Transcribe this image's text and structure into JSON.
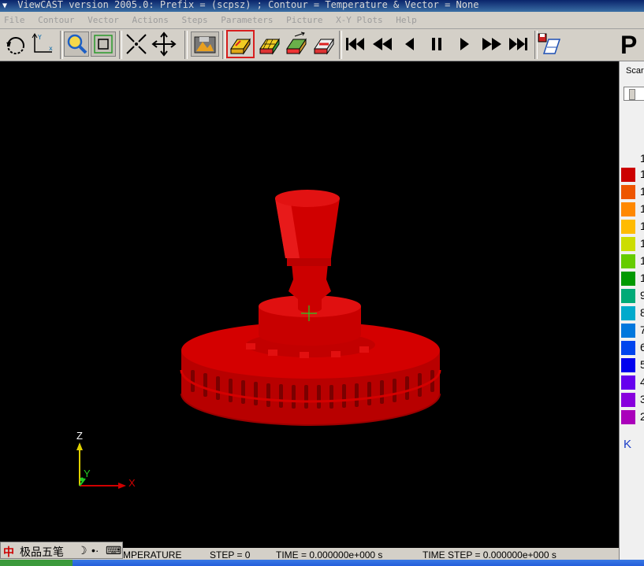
{
  "window": {
    "title": "ViewCAST version 2005.0:  Prefix = (scpsz) ; Contour = Temperature  &  Vector = None"
  },
  "menu": [
    "File",
    "Contour",
    "Vector",
    "Actions",
    "Steps",
    "Parameters",
    "Picture",
    "X-Y Plots",
    "Help"
  ],
  "toolbar": {
    "icons": [
      "rotate-icon",
      "axes-icon",
      "zoom-icon",
      "fit-window-icon",
      "shrink-icon",
      "pan-icon",
      "save-picture-icon",
      "contour-mode-icon",
      "contour-mesh-icon",
      "vector-mode-icon",
      "section-mode-icon",
      "first-step-icon",
      "fast-rewind-icon",
      "step-back-icon",
      "pause-icon",
      "step-forward-icon",
      "fast-forward-icon",
      "last-step-icon",
      "record-icon"
    ]
  },
  "right_panel": {
    "partial_title": "P",
    "scan_label": "Scar",
    "legend_top_label": "1",
    "legend": [
      {
        "label": "1",
        "color": "#cc0000"
      },
      {
        "label": "1",
        "color": "#ee5500"
      },
      {
        "label": "1",
        "color": "#ff8800"
      },
      {
        "label": "1",
        "color": "#ffbb00"
      },
      {
        "label": "1",
        "color": "#ccdd00"
      },
      {
        "label": "1",
        "color": "#66cc00"
      },
      {
        "label": "1",
        "color": "#009900"
      },
      {
        "label": "9",
        "color": "#00aa77"
      },
      {
        "label": "8",
        "color": "#00aacc"
      },
      {
        "label": "7",
        "color": "#0077dd"
      },
      {
        "label": "6",
        "color": "#0044ee"
      },
      {
        "label": "5",
        "color": "#0000ee"
      },
      {
        "label": "4",
        "color": "#6600ee"
      },
      {
        "label": "3",
        "color": "#8800dd"
      },
      {
        "label": "2",
        "color": "#aa00bb"
      }
    ],
    "unit": "K"
  },
  "axes": {
    "z": "Z",
    "y": "Y",
    "x": "X"
  },
  "status": {
    "field": "MPERATURE",
    "step": "STEP = 0",
    "time": "TIME = 0.000000e+000 s",
    "time_step": "TIME STEP = 0.000000e+000 s"
  },
  "ime": {
    "logo": "中",
    "name": "极品五笔",
    "moon": "☽",
    "punct": "•·",
    "keyboard": "⌨"
  },
  "colors": {
    "model": "#d40000",
    "viewport_bg": "#000000",
    "crosshair": "#22cc22"
  }
}
